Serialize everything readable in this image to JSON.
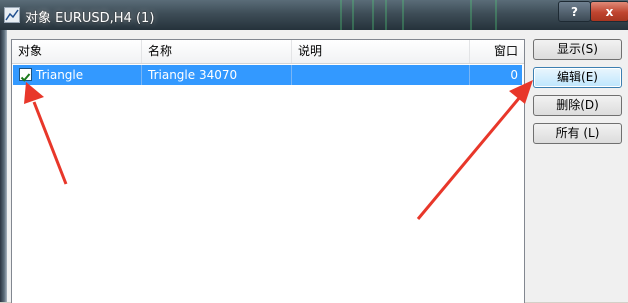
{
  "window": {
    "title": "对象 EURUSD,H4 (1)",
    "help_label": "?",
    "close_label": "x"
  },
  "list": {
    "columns": [
      "对象",
      "名称",
      "说明",
      "窗口"
    ],
    "rows": [
      {
        "checked": true,
        "object": "Triangle",
        "name": "Triangle 34070",
        "description": "",
        "window": "0"
      }
    ]
  },
  "buttons": {
    "show": "显示(S)",
    "edit": "编辑(E)",
    "delete": "删除(D)",
    "all": "所有 (L)"
  },
  "colors": {
    "selection": "#3399ff",
    "annotation_arrow": "#e8372a"
  },
  "icons": {
    "app": "chart-icon",
    "check": "checkmark-icon"
  }
}
